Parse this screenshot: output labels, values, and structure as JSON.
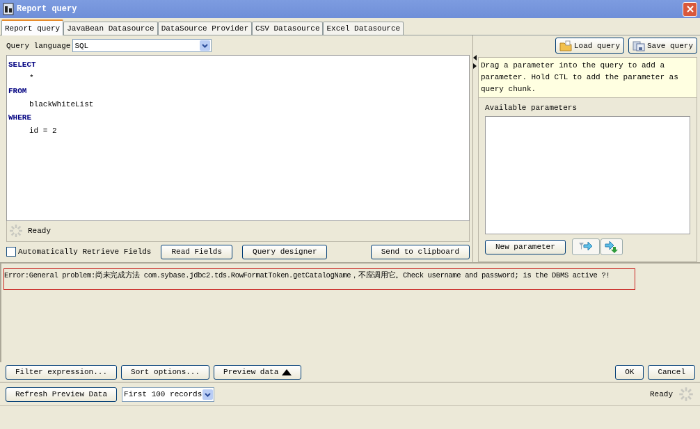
{
  "window": {
    "title": "Report query"
  },
  "tabs": [
    {
      "label": "Report query",
      "selected": true
    },
    {
      "label": "JavaBean Datasource",
      "selected": false
    },
    {
      "label": "DataSource Provider",
      "selected": false
    },
    {
      "label": "CSV Datasource",
      "selected": false
    },
    {
      "label": "Excel Datasource",
      "selected": false
    }
  ],
  "query_language": {
    "label": "Query language",
    "value": "SQL"
  },
  "query_lines": [
    {
      "kind": "keyword",
      "text": "SELECT"
    },
    {
      "kind": "plain",
      "text": "*"
    },
    {
      "kind": "keyword",
      "text": "FROM"
    },
    {
      "kind": "plain",
      "text": "blackWhiteList"
    },
    {
      "kind": "keyword",
      "text": "WHERE"
    },
    {
      "kind": "plain",
      "text": "id = 2"
    }
  ],
  "editor_status": "Ready",
  "auto_retrieve": {
    "label": "Automatically Retrieve Fields",
    "checked": false
  },
  "query_buttons": [
    "Read Fields",
    "Query designer"
  ],
  "clipboard_button": "Send to clipboard",
  "file_buttons": [
    "Load query",
    "Save query"
  ],
  "hint": "Drag a parameter into the query to add a parameter. Hold CTL to add the parameter as query chunk.",
  "parameters": {
    "label": "Available parameters",
    "new_button": "New parameter"
  },
  "error": "Error:General problem:尚未完成方法 com.sybase.jdbc2.tds.RowFormatToken.getCatalogName，不应调用它。Check username and password; is the DBMS active ?!",
  "option_buttons": [
    "Filter expression...",
    "Sort options..."
  ],
  "preview_button": {
    "label": "Preview data",
    "expanded": false
  },
  "dialog_buttons": [
    "OK",
    "Cancel"
  ],
  "preview": {
    "refresh_button": "Refresh Preview Data",
    "records": "First 100 records",
    "status": "Ready"
  }
}
